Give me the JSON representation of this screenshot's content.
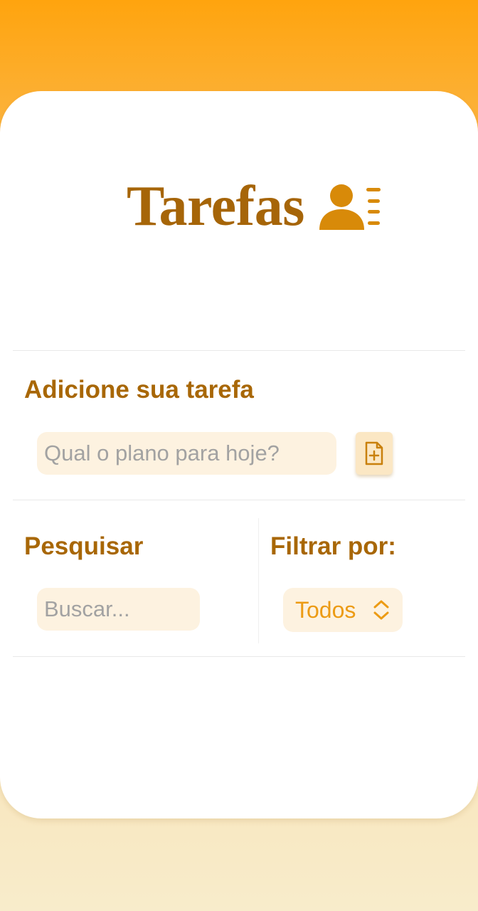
{
  "app": {
    "title": "Tarefas",
    "title_icon": "user-list-icon"
  },
  "add_section": {
    "title": "Adicione sua tarefa",
    "input_placeholder": "Qual o plano para hoje?",
    "input_value": "",
    "add_button_icon": "file-plus-icon"
  },
  "search_section": {
    "title": "Pesquisar",
    "input_placeholder": "Buscar...",
    "input_value": ""
  },
  "filter_section": {
    "title": "Filtrar por:",
    "selected_option": "Todos",
    "select_icon": "chevron-up-down-icon"
  },
  "colors": {
    "accent_dark": "#A86706",
    "accent": "#EC9B14",
    "input_bg": "#FDF2E0",
    "background_top": "#FFA40E",
    "background_bottom": "#F8ECCB"
  }
}
